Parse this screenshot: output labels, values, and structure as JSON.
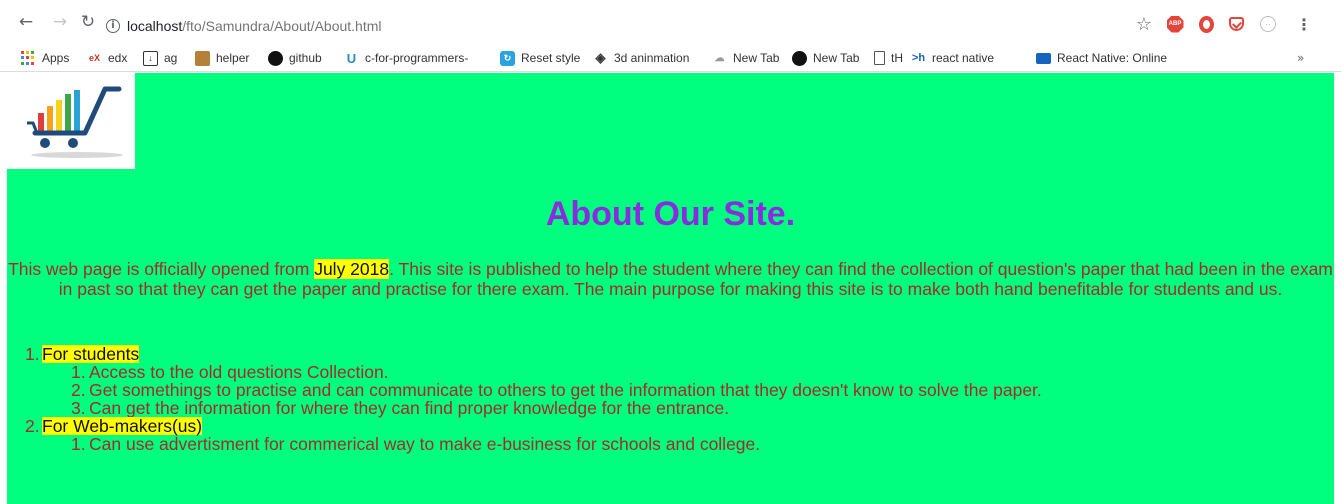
{
  "browser": {
    "url_host": "localhost",
    "url_path": "/fto/Samundra/About/About.html",
    "bookmarks": [
      {
        "label": "Apps",
        "icon": "apps-grid-icon"
      },
      {
        "label": "edx",
        "icon": "edx-icon"
      },
      {
        "label": "ag",
        "icon": "download-icon"
      },
      {
        "label": "helper",
        "icon": "helper-icon"
      },
      {
        "label": "github",
        "icon": "github-icon"
      },
      {
        "label": "c-for-programmers-",
        "icon": "udemy-icon"
      },
      {
        "label": "Reset style",
        "icon": "reset-style-icon"
      },
      {
        "label": "3d aninmation",
        "icon": "3d-animation-icon"
      },
      {
        "label": "New Tab",
        "icon": "newtab-icon"
      },
      {
        "label": "New Tab",
        "icon": "github-icon"
      },
      {
        "label": "tH",
        "icon": "page-icon"
      },
      {
        "label": "react native",
        "icon": "terminal-icon"
      },
      {
        "label": "React Native: Online",
        "icon": "video-icon"
      }
    ],
    "abp_label": "ABP",
    "overflow_label": "»"
  },
  "page": {
    "title": "About Our Site.",
    "intro_before": "This web page is officially opened from ",
    "intro_highlight": "July 2018",
    "intro_after": ". This site is published to help the student where they can find the collection of question's paper that had been in the exam in past so that they can get the paper and practise for there exam. The main purpose for making this site is to make both hand benefitable for students and us.",
    "sections": [
      {
        "num": "1.",
        "label": "For students",
        "items": [
          {
            "num": "1.",
            "text": "Access to the old questions Collection."
          },
          {
            "num": "2.",
            "text": "Get somethings to practise and can communicate to others to get the information that they doesn't know to solve the paper."
          },
          {
            "num": "3.",
            "text": "Can get the information for where they can find proper knowledge for the entrance."
          }
        ]
      },
      {
        "num": "2.",
        "label": "For Web-makers(us)",
        "items": [
          {
            "num": "1.",
            "text": "Can use advertisment for commerical way to make e-business for schools and college."
          }
        ]
      }
    ]
  },
  "colors": {
    "page_background": "#00ff7f",
    "title": "#8a2be2",
    "body_text": "#a52a2a",
    "highlight": "#ffff00"
  }
}
